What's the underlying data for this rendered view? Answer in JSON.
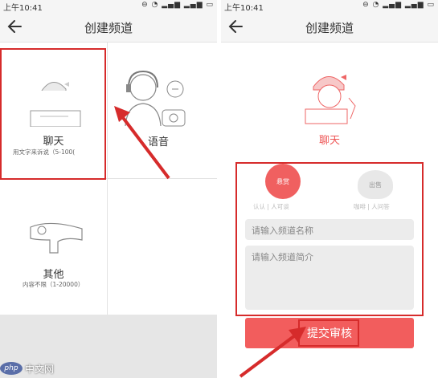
{
  "left_screen": {
    "status_time": "上午10:41",
    "status_icons": "⊖ ◔ ▂▄▆ ▂▄▆ ▭",
    "title": "创建频道",
    "chat": {
      "label": "聊天",
      "sub": "用文字来诉说（5-100("
    },
    "voice": {
      "label": "语音"
    },
    "other": {
      "label": "其他",
      "sub": "内容不限（1-20000）"
    }
  },
  "right_screen": {
    "status_time": "上午10:41",
    "status_icons": "⊖ ◔ ▂▄▆ ▂▄▆ ▭",
    "title": "创建频道",
    "chat_label": "聊天",
    "option_left": {
      "badge": "悬赏",
      "caption": "认认 | 人可谈"
    },
    "option_right": {
      "badge": "出售",
      "caption": "咖啡 | 人问答"
    },
    "name_placeholder": "请输入频道名称",
    "intro_placeholder": "请输入频道简介",
    "submit_label": "提交审核"
  },
  "watermark": {
    "logo": "php",
    "text": "中文网"
  },
  "colors": {
    "accent": "#f25d5d",
    "highlight_box": "#d62b2b",
    "arrow": "#d62b2b"
  }
}
